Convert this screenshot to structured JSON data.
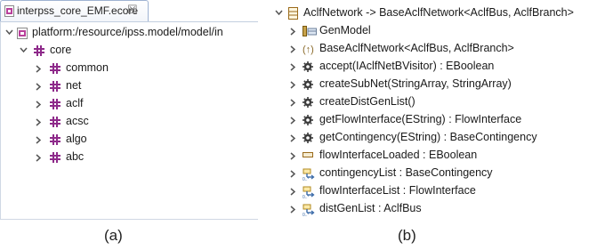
{
  "panel_a": {
    "tab": {
      "label": "interpss_core_EMF.ecore",
      "close": "☒"
    },
    "tree": {
      "root_label": "platform:/resource/ipss.model/model/in",
      "core_label": "core",
      "packages": [
        "common",
        "net",
        "aclf",
        "acsc",
        "algo",
        "abc"
      ]
    },
    "caption": "(a)"
  },
  "panel_b": {
    "root_label": "AclfNetwork -> BaseAclfNetwork<AclfBus, AclfBranch>",
    "members": [
      {
        "kind": "genmodel",
        "label": "GenModel"
      },
      {
        "kind": "supertype",
        "label": "BaseAclfNetwork<AclfBus, AclfBranch>"
      },
      {
        "kind": "operation",
        "label": "accept(IAclfNetBVisitor) : EBoolean"
      },
      {
        "kind": "operation",
        "label": "createSubNet(StringArray, StringArray)"
      },
      {
        "kind": "operation",
        "label": "createDistGenList()"
      },
      {
        "kind": "operation",
        "label": "getFlowInterface(EString) : FlowInterface"
      },
      {
        "kind": "operation",
        "label": "getContingency(EString) : BaseContingency"
      },
      {
        "kind": "attribute",
        "label": "flowInterfaceLoaded : EBoolean"
      },
      {
        "kind": "reference",
        "label": "contingencyList : BaseContingency"
      },
      {
        "kind": "reference",
        "label": "flowInterfaceList : FlowInterface"
      },
      {
        "kind": "reference",
        "label": "distGenList : AclfBus"
      }
    ],
    "caption": "(b)"
  },
  "colors": {
    "package_icon": "#8e2a8a",
    "class_icon": "#9a6a1a",
    "operation_icon": "#3c3c3c",
    "chevron": "#555555"
  }
}
